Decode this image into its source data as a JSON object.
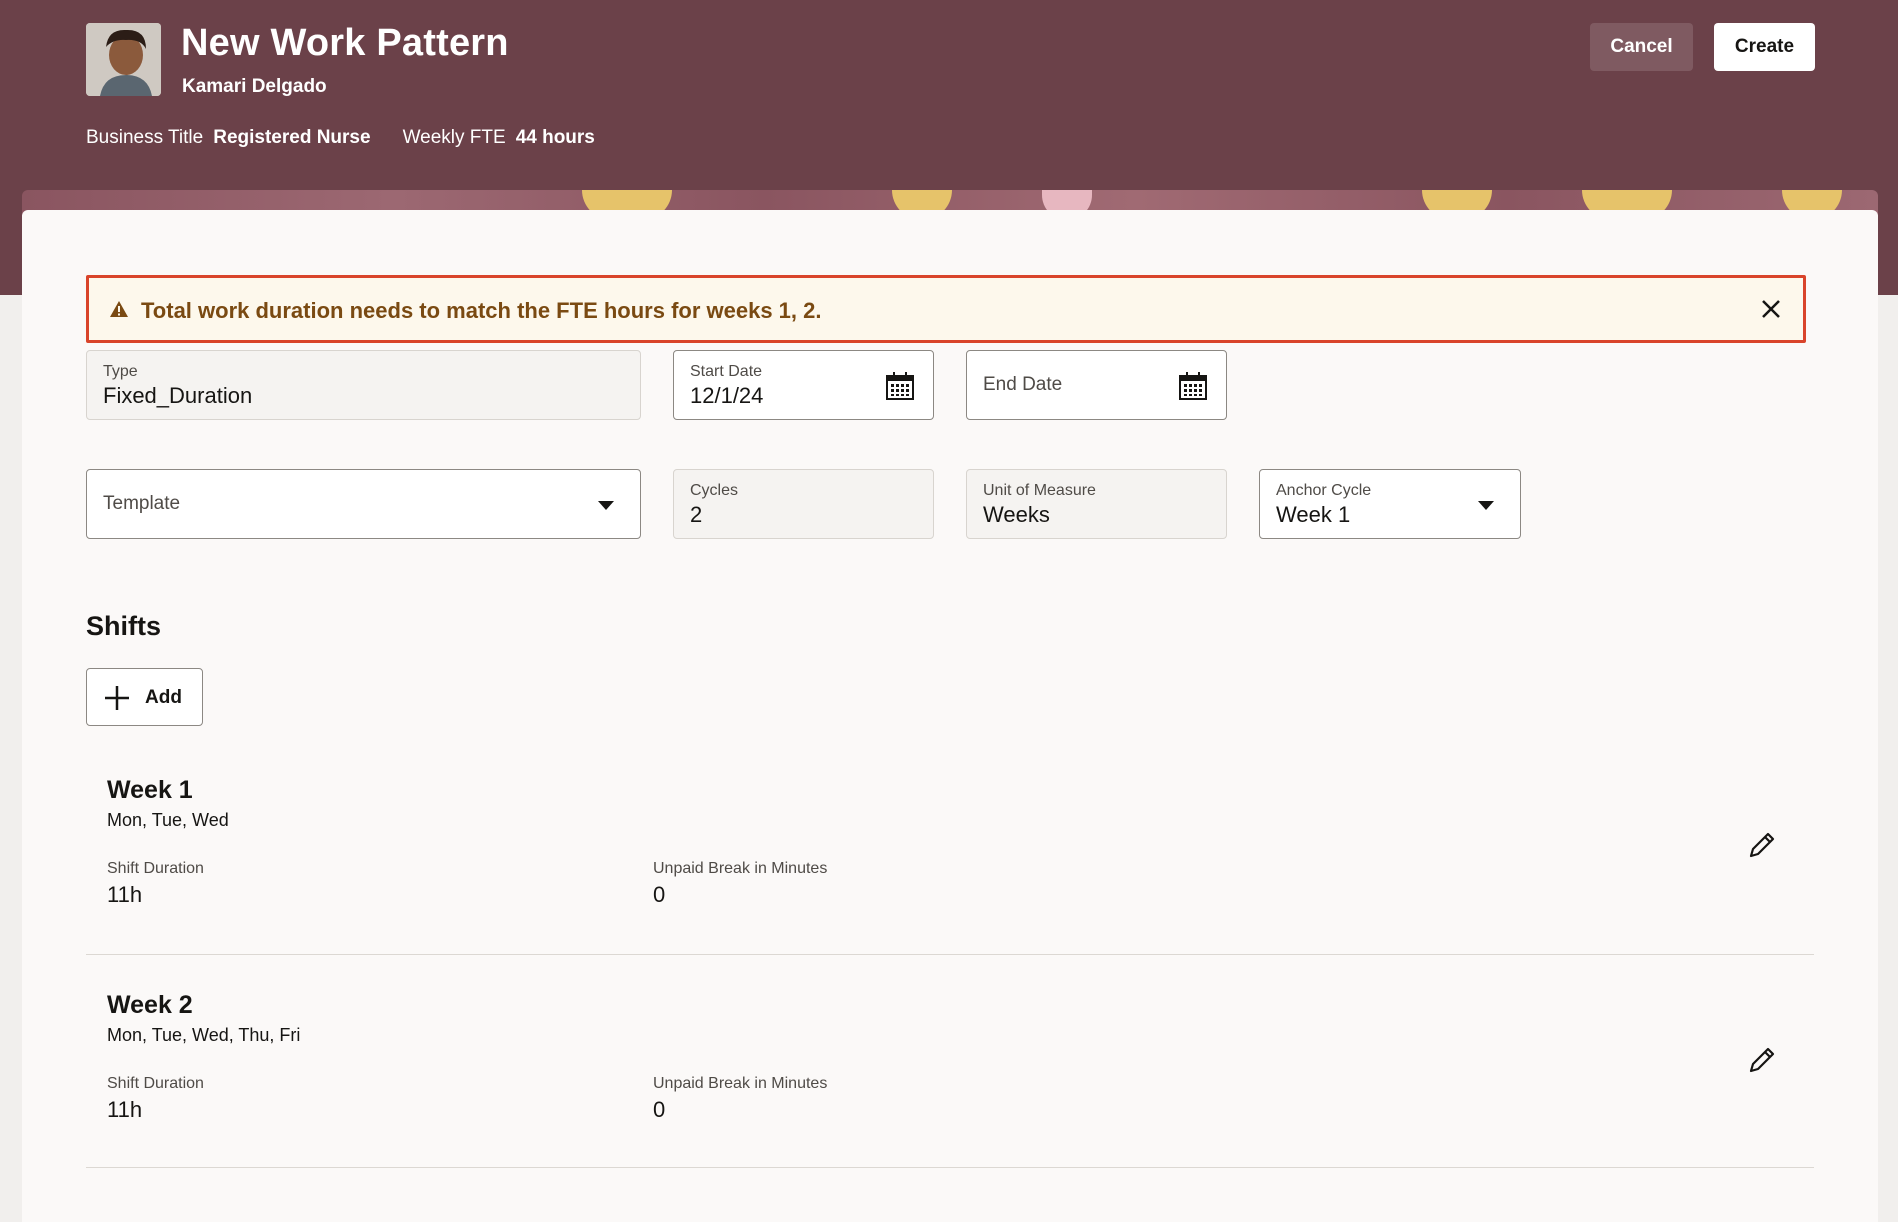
{
  "header": {
    "title": "New Work Pattern",
    "person_name": "Kamari Delgado",
    "business_title_label": "Business Title",
    "business_title_value": "Registered Nurse",
    "weekly_fte_label": "Weekly FTE",
    "weekly_fte_value": "44 hours",
    "cancel_label": "Cancel",
    "create_label": "Create",
    "bg_color": "#6b4149"
  },
  "alert": {
    "message": "Total work duration needs to match the FTE hours for weeks 1, 2.",
    "icon": "warning-icon",
    "border_color": "#d9442b"
  },
  "form": {
    "type": {
      "label": "Type",
      "value": "Fixed_Duration"
    },
    "start_date": {
      "label": "Start Date",
      "value": "12/1/24",
      "icon": "calendar-icon"
    },
    "end_date": {
      "label": "End Date",
      "value": "",
      "icon": "calendar-icon"
    },
    "template": {
      "label": "Template",
      "value": ""
    },
    "cycles": {
      "label": "Cycles",
      "value": "2"
    },
    "unit_of_measure": {
      "label": "Unit of Measure",
      "value": "Weeks"
    },
    "anchor_cycle": {
      "label": "Anchor Cycle",
      "value": "Week 1"
    }
  },
  "shifts": {
    "title": "Shifts",
    "add_label": "Add",
    "weeks": [
      {
        "title": "Week 1",
        "days": "Mon, Tue, Wed",
        "shift_duration_label": "Shift Duration",
        "shift_duration_value": "11h",
        "unpaid_break_label": "Unpaid Break in Minutes",
        "unpaid_break_value": "0"
      },
      {
        "title": "Week 2",
        "days": "Mon, Tue, Wed, Thu, Fri",
        "shift_duration_label": "Shift Duration",
        "shift_duration_value": "11h",
        "unpaid_break_label": "Unpaid Break in Minutes",
        "unpaid_break_value": "0"
      }
    ]
  }
}
